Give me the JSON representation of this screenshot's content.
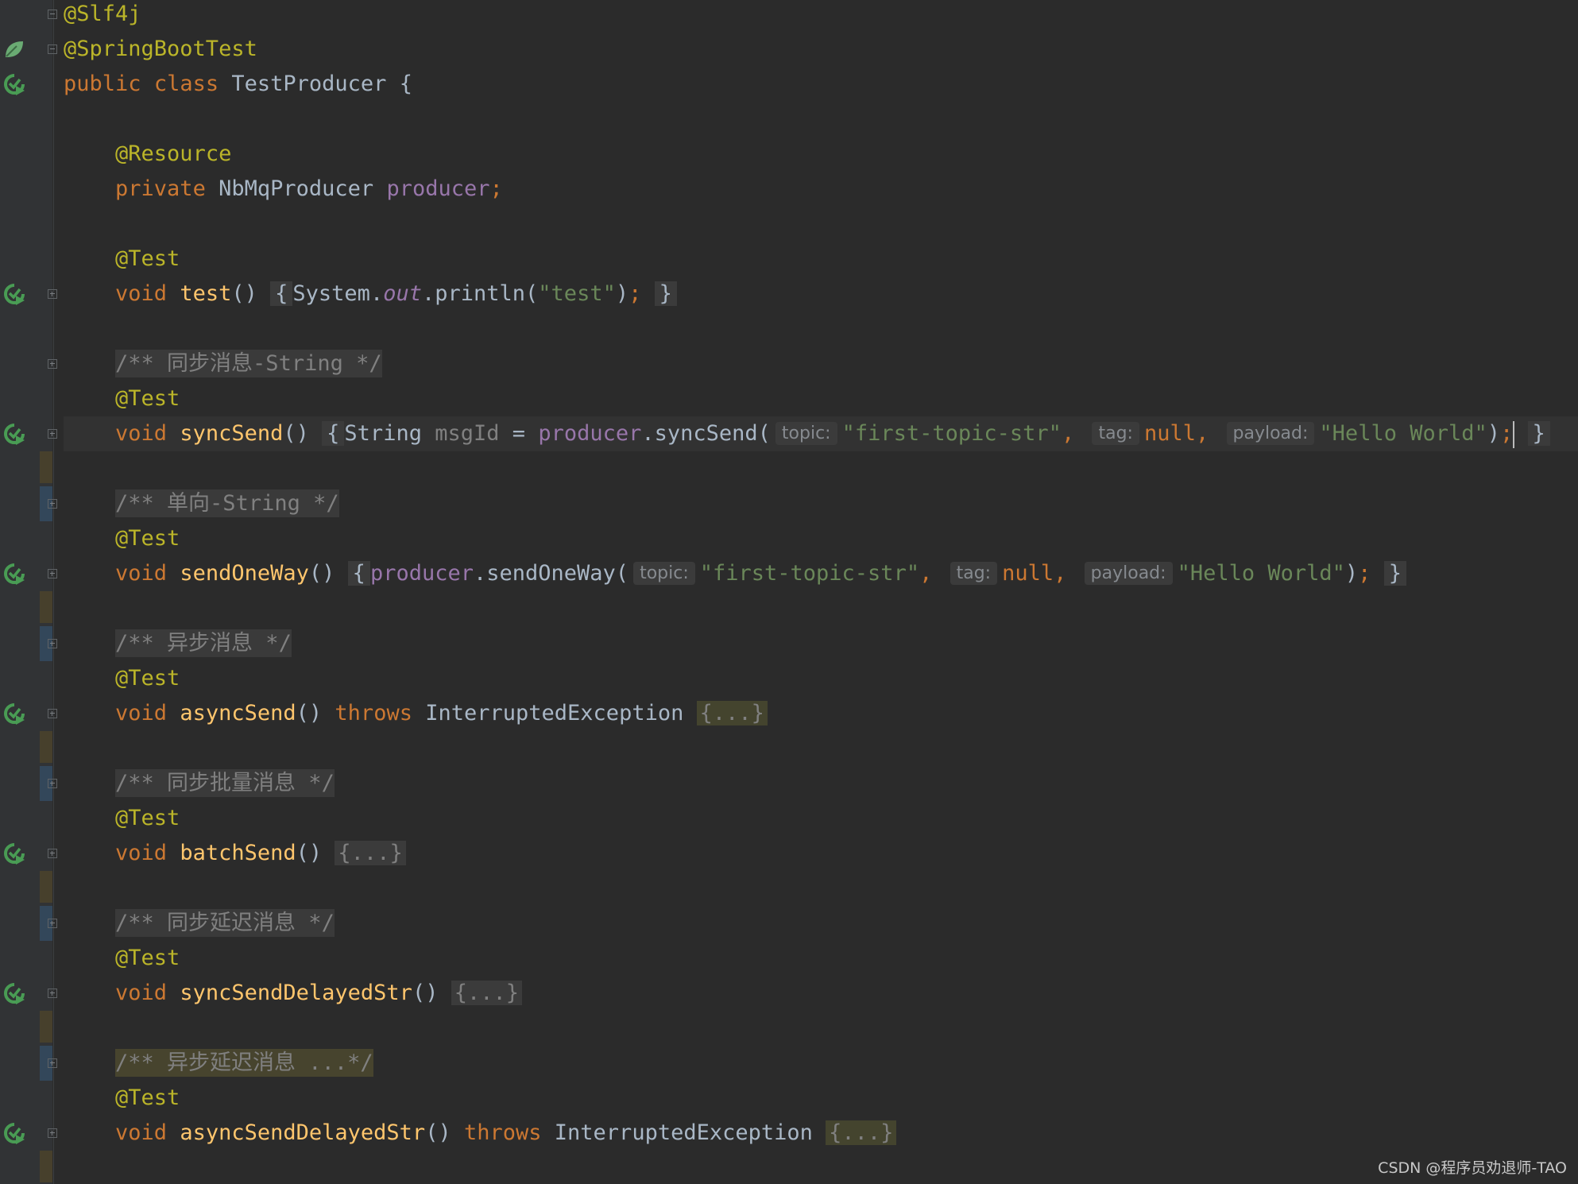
{
  "editor": {
    "lines": {
      "l1_annotation": "@Slf4j",
      "l2_annotation": "@SpringBootTest",
      "l3_public": "public",
      "l3_class": "class",
      "l3_classname": "TestProducer",
      "l3_brace": "{",
      "l5_annotation": "@Resource",
      "l6_private": "private",
      "l6_type": "NbMqProducer",
      "l6_field": "producer",
      "l6_semi": ";",
      "l8_annotation": "@Test",
      "l9_void": "void",
      "l9_name": "test",
      "l9_parens": "()",
      "l9_open": "{",
      "l9_system": "System.",
      "l9_out": "out",
      "l9_println": ".println(",
      "l9_str": "\"test\"",
      "l9_close_paren": ")",
      "l9_semi": ";",
      "l9_close": "}",
      "l11_comment": "/** 同步消息-String */",
      "l12_annotation": "@Test",
      "l13_void": "void",
      "l13_name": "syncSend",
      "l13_parens": "()",
      "l13_open": "{",
      "l13_type": "String",
      "l13_var": "msgId",
      "l13_eq": "=",
      "l13_field": "producer",
      "l13_call": ".syncSend(",
      "l13_hint_topic": "topic:",
      "l13_topic": "\"first-topic-str\"",
      "l13_comma1": ",",
      "l13_hint_tag": "tag:",
      "l13_null": "null",
      "l13_comma2": ",",
      "l13_hint_payload": "payload:",
      "l13_payload": "\"Hello World\"",
      "l13_close_paren": ")",
      "l13_semi": ";",
      "l13_close": "}",
      "l15_comment": "/** 单向-String */",
      "l16_annotation": "@Test",
      "l17_void": "void",
      "l17_name": "sendOneWay",
      "l17_parens": "()",
      "l17_open": "{",
      "l17_field": "producer",
      "l17_call": ".sendOneWay(",
      "l17_hint_topic": "topic:",
      "l17_topic": "\"first-topic-str\"",
      "l17_comma1": ",",
      "l17_hint_tag": "tag:",
      "l17_null": "null",
      "l17_comma2": ",",
      "l17_hint_payload": "payload:",
      "l17_payload": "\"Hello World\"",
      "l17_close_paren": ")",
      "l17_semi": ";",
      "l17_close": "}",
      "l19_comment": "/** 异步消息 */",
      "l20_annotation": "@Test",
      "l21_void": "void",
      "l21_name": "asyncSend",
      "l21_parens": "()",
      "l21_throws": "throws",
      "l21_exc": "InterruptedException",
      "l21_folded": "{...}",
      "l23_comment": "/** 同步批量消息 */",
      "l24_annotation": "@Test",
      "l25_void": "void",
      "l25_name": "batchSend",
      "l25_parens": "()",
      "l25_folded": "{...}",
      "l27_comment": "/** 同步延迟消息 */",
      "l28_annotation": "@Test",
      "l29_void": "void",
      "l29_name": "syncSendDelayedStr",
      "l29_parens": "()",
      "l29_folded": "{...}",
      "l31_comment": "/** 异步延迟消息 ...*/",
      "l32_annotation": "@Test",
      "l33_void": "void",
      "l33_name": "asyncSendDelayedStr",
      "l33_parens": "()",
      "l33_throws": "throws",
      "l33_exc": "InterruptedException",
      "l33_folded": "{...}"
    }
  },
  "gutter_icons": {
    "spring": "spring-bean-icon",
    "run": "run-test-icon",
    "fold": "fold-toggle-icon"
  },
  "colors": {
    "background": "#2b2b2b",
    "gutter": "#313335",
    "keyword": "#cc7832",
    "annotation": "#bbb529",
    "string": "#6a8759",
    "method": "#ffc66d",
    "field": "#9876aa",
    "comment": "#808080",
    "run_icon": "#499c54"
  },
  "watermark": "CSDN @程序员劝退师-TAO"
}
